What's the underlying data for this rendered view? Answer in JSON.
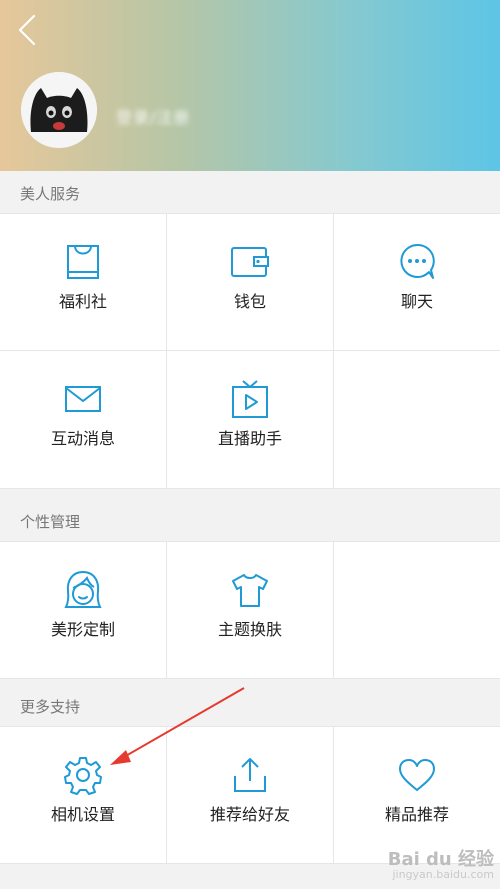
{
  "header": {
    "login_text": "登录/注册"
  },
  "sections": [
    {
      "title": "美人服务",
      "items": [
        {
          "label": "福利社",
          "icon": "shopping-bag-icon"
        },
        {
          "label": "钱包",
          "icon": "wallet-icon"
        },
        {
          "label": "聊天",
          "icon": "chat-bubble-icon"
        },
        {
          "label": "互动消息",
          "icon": "envelope-icon"
        },
        {
          "label": "直播助手",
          "icon": "tv-play-icon"
        }
      ]
    },
    {
      "title": "个性管理",
      "items": [
        {
          "label": "美形定制",
          "icon": "face-icon"
        },
        {
          "label": "主题换肤",
          "icon": "tshirt-icon"
        }
      ]
    },
    {
      "title": "更多支持",
      "items": [
        {
          "label": "相机设置",
          "icon": "gear-icon"
        },
        {
          "label": "推荐给好友",
          "icon": "share-upload-icon"
        },
        {
          "label": "精品推荐",
          "icon": "heart-icon"
        }
      ]
    }
  ],
  "watermark": {
    "brand": "Bai du 经验",
    "url": "jingyan.baidu.com"
  },
  "colors": {
    "accent": "#1f9ad6",
    "arrow": "#e63a2e"
  }
}
